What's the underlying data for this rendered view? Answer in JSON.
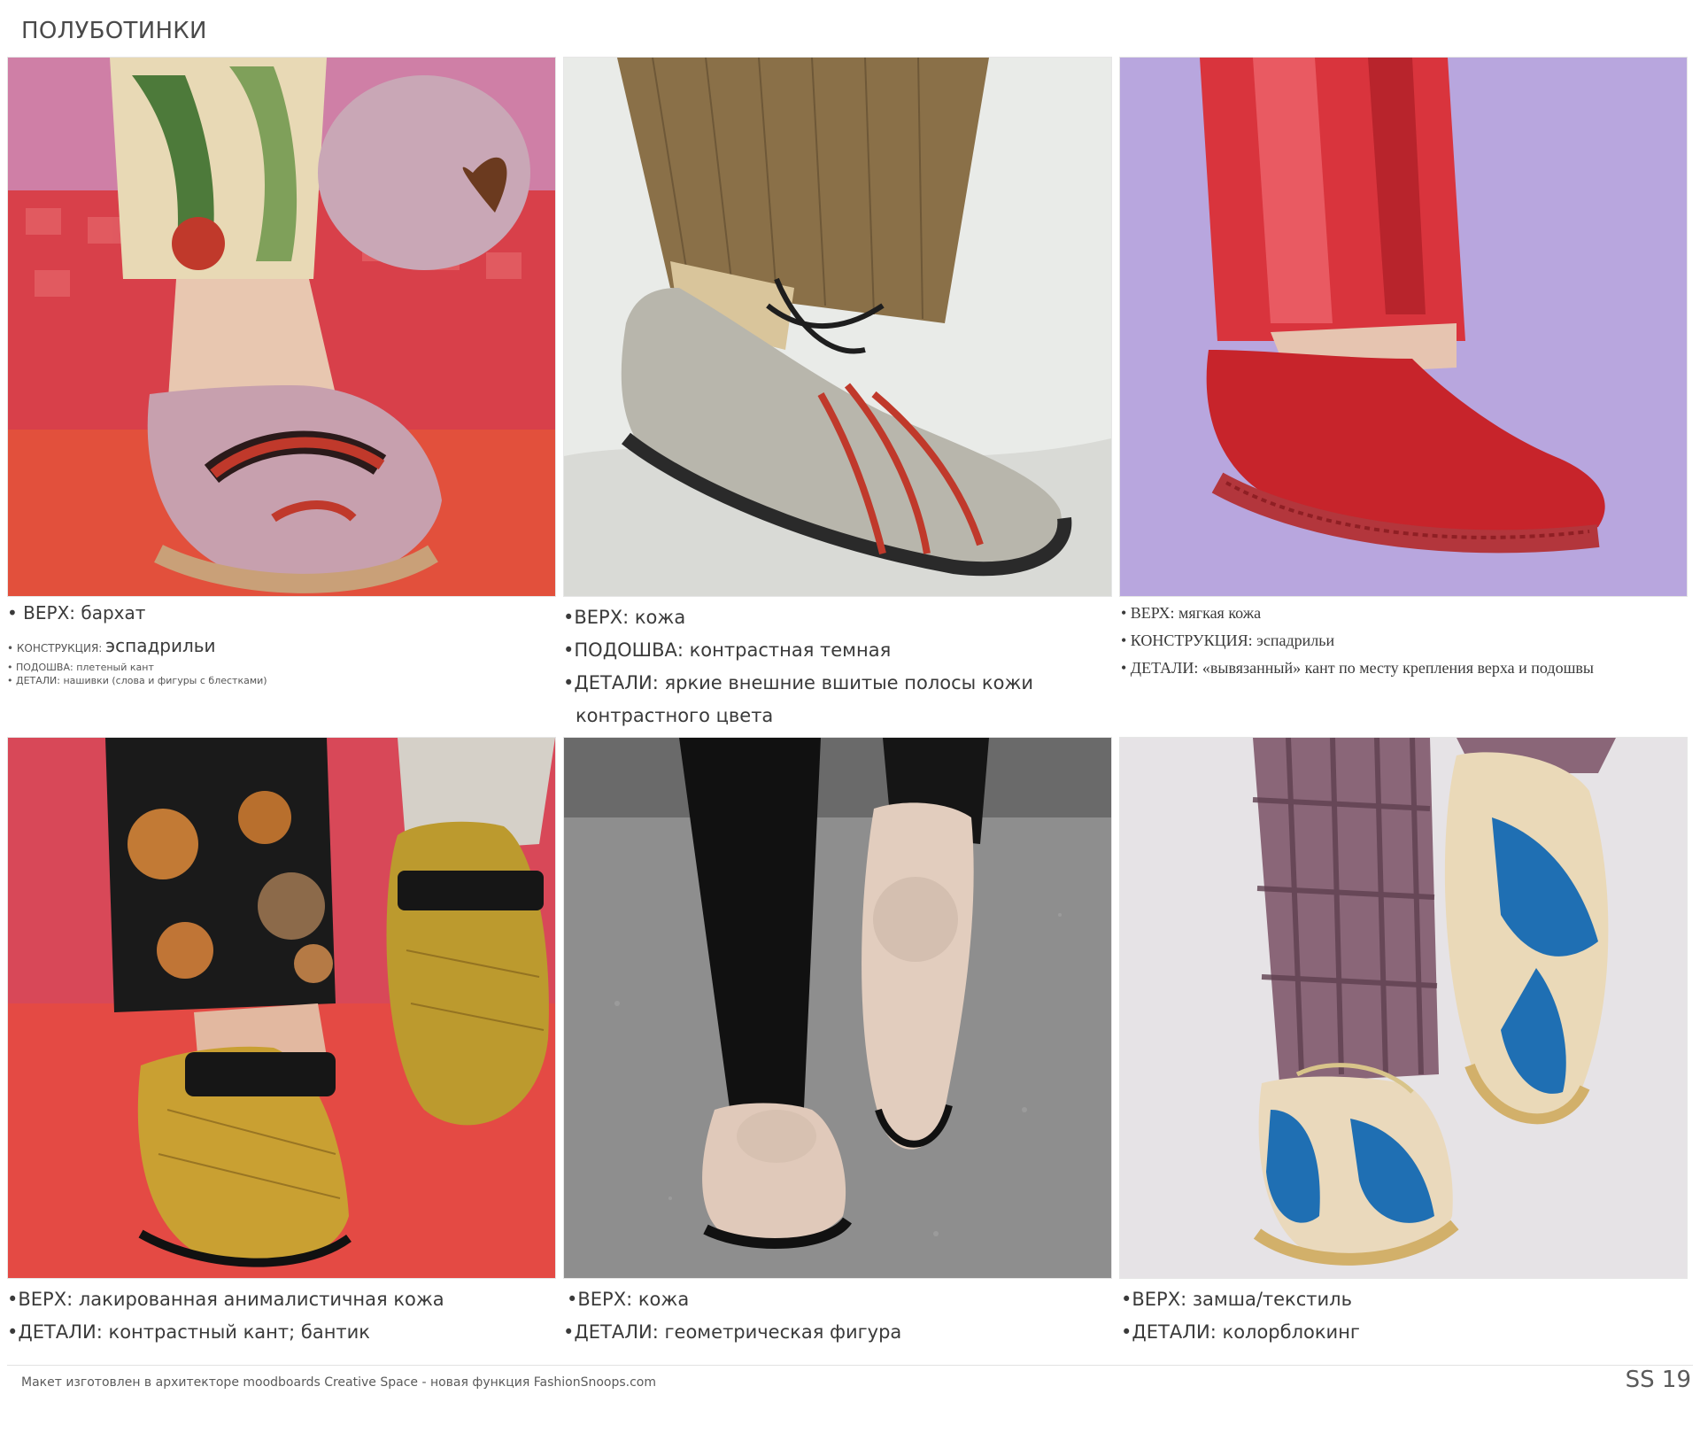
{
  "page": {
    "title": "ПОЛУБОТИНКИ",
    "footer_note": "Макет изготовлен в архитекторе moodboards Creative Space - новая функция FashionSnoops.com",
    "season": "SS 19"
  },
  "cells": [
    {
      "photo_alt": "velvet espadrille",
      "lines": [
        {
          "text": "• ВЕРХ: бархат"
        },
        {
          "key": "• КОНСТРУКЦИЯ: ",
          "value": "эспадрильи"
        },
        {
          "text": "• ПОДОШВА: плетеный кант"
        },
        {
          "text": "• ДЕТАЛИ: нашивки (слова и фигуры с блестками)"
        }
      ]
    },
    {
      "photo_alt": "grey leather derby",
      "lines": [
        {
          "text": "•ВЕРХ: кожа"
        },
        {
          "text": "•ПОДОШВА: контрастная темная"
        },
        {
          "text": "•ДЕТАЛИ: яркие внешние вшитые полосы кожи"
        },
        {
          "text": "контрастного цвета"
        }
      ]
    },
    {
      "photo_alt": "red leather espadrille",
      "lines": [
        {
          "text": "• ВЕРХ: мягкая кожа"
        },
        {
          "text": "• КОНСТРУКЦИЯ: эспадрильи"
        },
        {
          "text": "• ДЕТАЛИ: «вывязанный» кант по месту крепления верха и подошвы"
        }
      ]
    },
    {
      "photo_alt": "snake patent loafer",
      "lines": [
        {
          "text": "•ВЕРХ: лакированная анималистичная кожа"
        },
        {
          "text": "•ДЕТАЛИ: контрастный кант; бантик"
        }
      ]
    },
    {
      "photo_alt": "nude patent loafer",
      "lines": [
        {
          "text": "•ВЕРХ: кожа"
        },
        {
          "text": "•ДЕТАЛИ: геометрическая фигура"
        }
      ]
    },
    {
      "photo_alt": "colorblock suede shoe",
      "lines": [
        {
          "text": "•ВЕРХ: замша/текстиль"
        },
        {
          "text": "•ДЕТАЛИ: колорблокинг"
        }
      ]
    }
  ]
}
